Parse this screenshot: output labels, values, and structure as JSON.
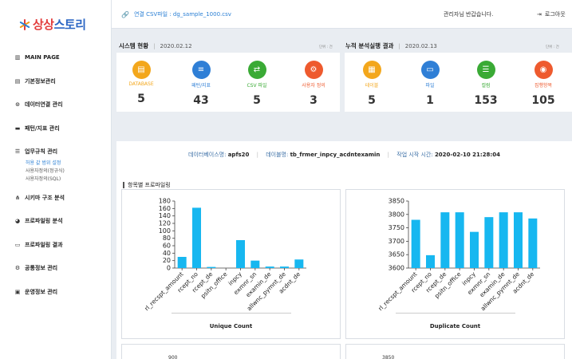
{
  "logo": {
    "part_a": "상상",
    "part_b": "스토리"
  },
  "sidebar": {
    "items": [
      {
        "label": "MAIN PAGE",
        "icon": "bar-chart-icon"
      },
      {
        "label": "기본정보관리",
        "icon": "chart-icon"
      },
      {
        "label": "데이터연결 관리",
        "icon": "link-icon"
      },
      {
        "label": "패턴/지표 관리",
        "icon": "pattern-icon"
      },
      {
        "label": "업무규칙 관리",
        "icon": "list-icon"
      },
      {
        "label": "시키마 구조 분석",
        "icon": "hierarchy-icon"
      },
      {
        "label": "프로파일링 분석",
        "icon": "pie-icon"
      },
      {
        "label": "프로파일링 결과",
        "icon": "monitor-icon"
      },
      {
        "label": "공통정보 관리",
        "icon": "gear-icon"
      },
      {
        "label": "운영정보 관리",
        "icon": "calendar-icon"
      }
    ],
    "subitems": [
      "허용 값 범위 설정",
      "사용자정의(정규식)",
      "사용자정의(SQL)"
    ]
  },
  "topbar": {
    "csv_label": "연결 CSV파일 : dg_sample_1000.csv",
    "welcome": "관리자님 반갑습니다.",
    "logout": "로그아웃"
  },
  "system_status": {
    "title": "시스템 현황",
    "date": "2020.02.12",
    "unit": "단위 : 건",
    "stats": [
      {
        "label": "DATABASE",
        "value": "5",
        "color": "#f3a71c",
        "icon": "database-icon",
        "glyph": "▤"
      },
      {
        "label": "패턴/지표",
        "value": "43",
        "color": "#2f7fd6",
        "icon": "pattern-icon",
        "glyph": "≡"
      },
      {
        "label": "CSV 파일",
        "value": "5",
        "color": "#3aaa35",
        "icon": "csv-file-icon",
        "glyph": "⇄"
      },
      {
        "label": "사용자 정의",
        "value": "3",
        "color": "#ee5a2e",
        "icon": "user-define-icon",
        "glyph": "⚙"
      }
    ]
  },
  "cumulative": {
    "title": "누적 분석실행 결과",
    "date": "2020.02.13",
    "unit": "단위 : 건",
    "stats": [
      {
        "label": "테이블",
        "value": "5",
        "color": "#f3a71c",
        "icon": "table-icon",
        "glyph": "▦"
      },
      {
        "label": "파일",
        "value": "1",
        "color": "#2f7fd6",
        "icon": "file-icon",
        "glyph": "▭"
      },
      {
        "label": "컬럼",
        "value": "153",
        "color": "#3aaa35",
        "icon": "column-icon",
        "glyph": "☰"
      },
      {
        "label": "집행항목",
        "value": "105",
        "color": "#ee5a2e",
        "icon": "execution-icon",
        "glyph": "◉"
      }
    ]
  },
  "info": {
    "db_label": "데이터베이스명:",
    "db_value": "apfs20",
    "table_label": "데이블명:",
    "table_value": "tb_frmer_inpcy_acdntexamin",
    "time_label": "작업 시작 시간:",
    "time_value": "2020-02-10 21:28:04"
  },
  "section_title": "항목별 프로파일링",
  "chart_data": [
    {
      "type": "bar",
      "title": "Unique Count",
      "categories": [
        "rl_recspt_amount",
        "rcept_no",
        "rcept_de",
        "psitn_office",
        "inpcy",
        "exmnr_sn",
        "examin_de",
        "allwnc_pymnt_de",
        "acdnt_de"
      ],
      "values": [
        30,
        162,
        3,
        0,
        75,
        20,
        4,
        4,
        23
      ],
      "ylim": [
        0,
        180
      ],
      "yticks": [
        0,
        20,
        40,
        60,
        80,
        100,
        120,
        140,
        160,
        180
      ],
      "color": "#17b7f0"
    },
    {
      "type": "bar",
      "title": "Duplicate Count",
      "categories": [
        "rl_recspt_amount",
        "rcept_no",
        "rcept_de",
        "psitn_office",
        "inpcy",
        "exmnr_sn",
        "examin_de",
        "allwnc_pymnt_de",
        "acdnt_de"
      ],
      "values": [
        3780,
        3648,
        3808,
        3808,
        3735,
        3790,
        3808,
        3808,
        3785
      ],
      "ylim": [
        3600,
        3850
      ],
      "yticks": [
        3600,
        3650,
        3700,
        3750,
        3800,
        3850
      ],
      "color": "#17b7f0"
    }
  ],
  "peek": {
    "left_tick": "900",
    "right_tick": "3850"
  }
}
